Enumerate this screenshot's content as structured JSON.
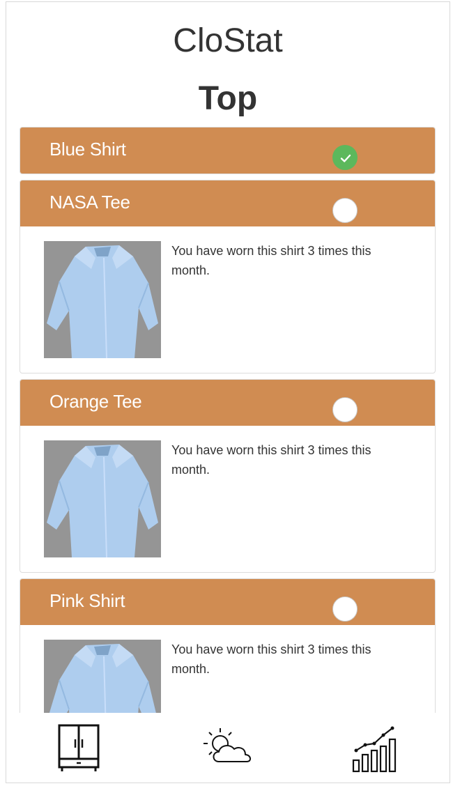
{
  "app": {
    "title": "CloStat"
  },
  "section": {
    "title": "Top"
  },
  "items": [
    {
      "name": "Blue Shirt",
      "checked": true,
      "expanded": false
    },
    {
      "name": "NASA Tee",
      "checked": false,
      "expanded": true,
      "description": "You have worn this shirt 3 times this month."
    },
    {
      "name": "Orange Tee",
      "checked": false,
      "expanded": true,
      "description": "You have worn this shirt 3 times this month."
    },
    {
      "name": "Pink Shirt",
      "checked": false,
      "expanded": true,
      "description": "You have worn this shirt 3 times this month."
    }
  ],
  "nav": [
    {
      "icon": "wardrobe-icon"
    },
    {
      "icon": "weather-icon"
    },
    {
      "icon": "stats-chart-icon"
    }
  ],
  "colors": {
    "header": "#d08c52",
    "checked": "#5cb85c",
    "text": "#333333"
  }
}
